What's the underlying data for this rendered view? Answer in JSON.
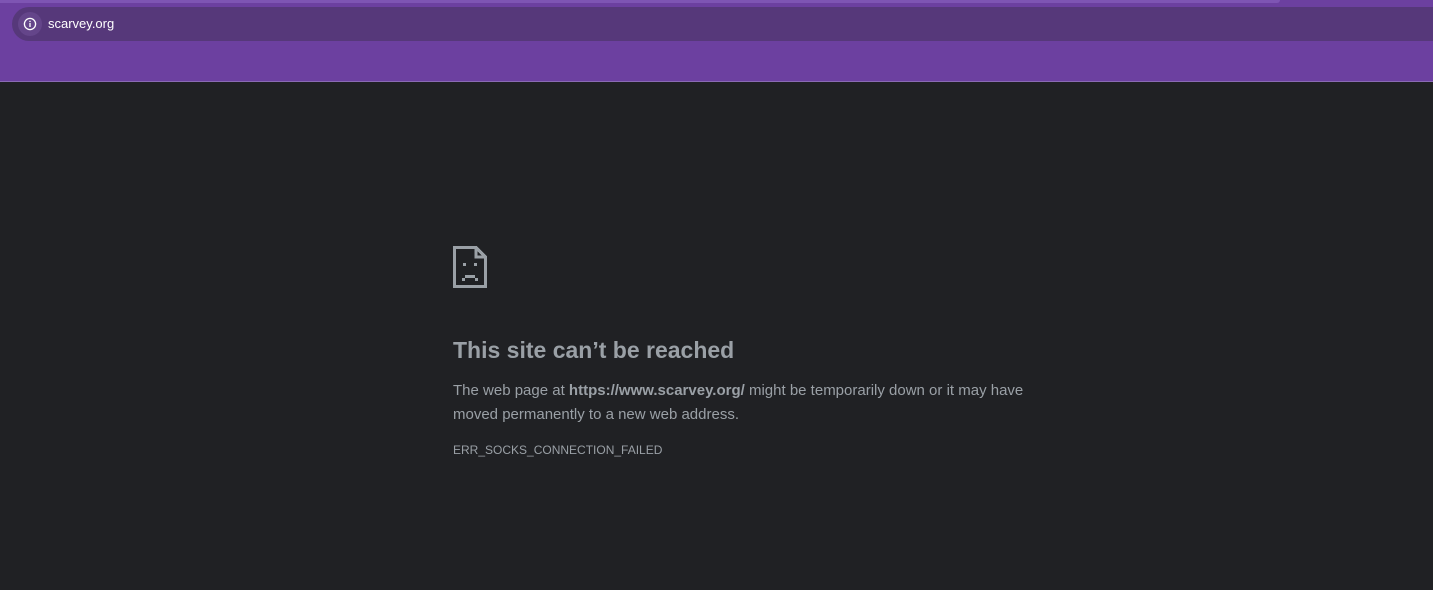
{
  "browser": {
    "address_bar": {
      "url": "scarvey.org",
      "site_info_icon": "info-circle-icon"
    },
    "colors": {
      "toolbar": "#6c40a0",
      "omnibox": "#56387a",
      "page_background": "#202124",
      "text": "#9aa0a6"
    }
  },
  "error_page": {
    "icon": "sad-page-icon",
    "title": "This site can’t be reached",
    "description": {
      "before_url": "The web page at ",
      "url": "https://www.scarvey.org/",
      "after_url": " might be temporarily down or it may have moved permanently to a new web address."
    },
    "error_code": "ERR_SOCKS_CONNECTION_FAILED"
  }
}
